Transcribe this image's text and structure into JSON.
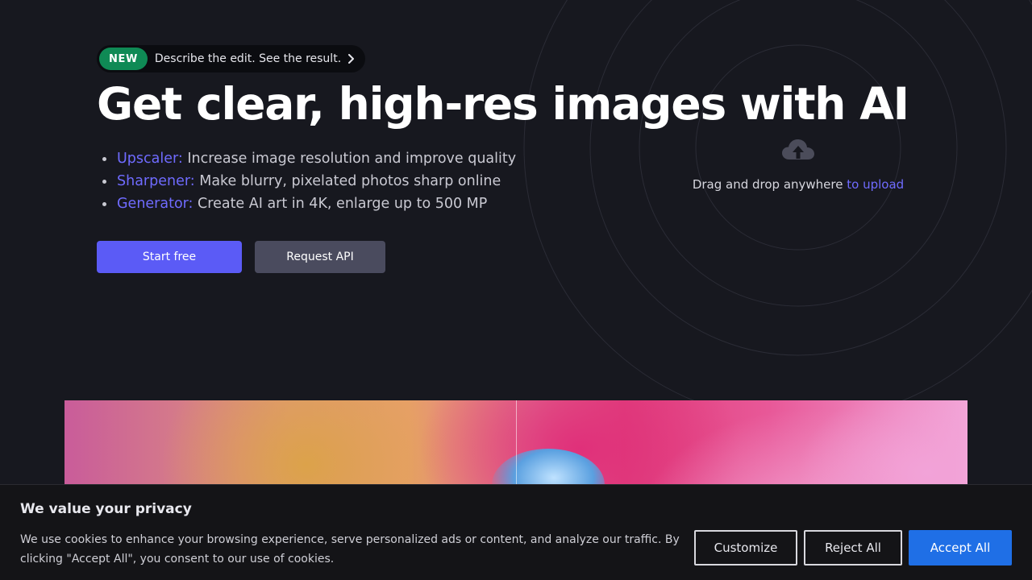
{
  "badge": {
    "label": "NEW",
    "text": "Describe the edit. See the result."
  },
  "hero": {
    "title": "Get clear, high-res images with AI",
    "features": [
      {
        "name": "Upscaler:",
        "desc": "Increase image resolution and improve quality"
      },
      {
        "name": "Sharpener:",
        "desc": "Make blurry, pixelated photos sharp online"
      },
      {
        "name": "Generator:",
        "desc": "Create AI art in 4K, enlarge up to 500 MP"
      }
    ],
    "primary_button": "Start free",
    "secondary_button": "Request API"
  },
  "upload": {
    "icon": "cloud-upload-icon",
    "text": "Drag and drop anywhere",
    "link": "to upload"
  },
  "cookie": {
    "title": "We value your privacy",
    "text": "We use cookies to enhance your browsing experience, serve personalized ads or content, and analyze our traffic. By clicking \"Accept All\", you consent to our use of cookies.",
    "customize": "Customize",
    "reject": "Reject All",
    "accept": "Accept All"
  },
  "colors": {
    "background": "#17181f",
    "accent": "#6f6bff",
    "primary_button": "#5b5bf6",
    "new_badge": "#0f8a55",
    "accept_button": "#1f6fe6"
  }
}
